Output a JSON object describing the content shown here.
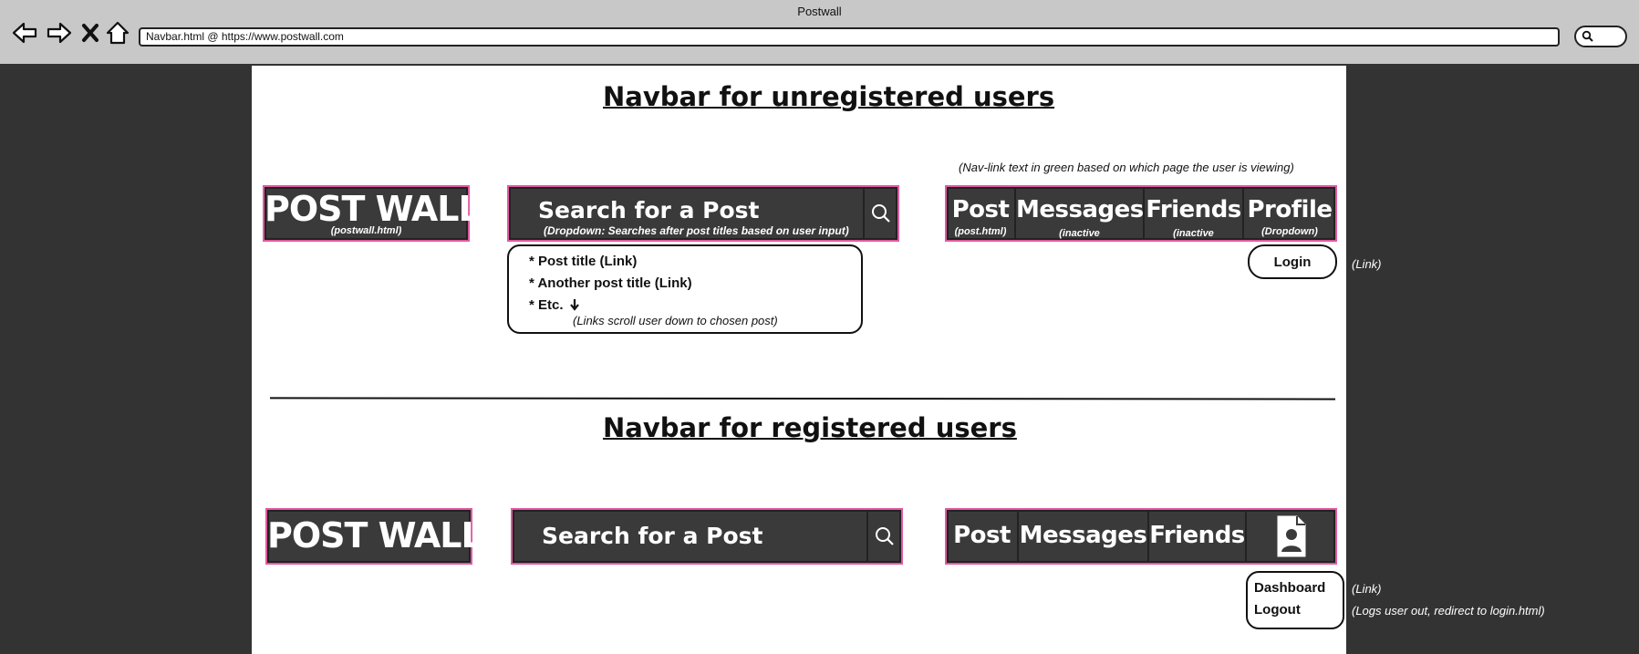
{
  "browser": {
    "title": "Postwall",
    "url": "Navbar.html @ https://www.postwall.com"
  },
  "section1": {
    "heading": "Navbar for unregistered users",
    "nav_note": "(Nav-link text in green based on which page the user is viewing)",
    "logo": {
      "text": "POST WALL",
      "sub": "(postwall.html)"
    },
    "search": {
      "placeholder": "Search for a Post",
      "sub": "(Dropdown: Searches after post titles based on user input)"
    },
    "nav": [
      {
        "label": "Post",
        "sub": "(post.html)"
      },
      {
        "label": "Messages",
        "sub": "(inactive"
      },
      {
        "label": "Friends",
        "sub": "(inactive"
      },
      {
        "label": "Profile",
        "sub": "(Dropdown)"
      }
    ],
    "dropdown": {
      "items": [
        "* Post title (Link)",
        "* Another post title (Link)",
        "* Etc."
      ],
      "note": "(Links scroll user down to chosen post)"
    },
    "login": {
      "label": "Login",
      "note": "(Link)"
    }
  },
  "section2": {
    "heading": "Navbar for registered users",
    "logo": {
      "text": "POST WALL"
    },
    "search": {
      "placeholder": "Search for a Post"
    },
    "nav": [
      {
        "label": "Post"
      },
      {
        "label": "Messages"
      },
      {
        "label": "Friends"
      }
    ],
    "profile_icon": "user-profile-icon",
    "profile_menu": {
      "items": [
        "Dashboard",
        "Logout"
      ],
      "notes": [
        "(Link)",
        "(Logs user out, redirect to login.html)"
      ]
    }
  },
  "colors": {
    "navbar_bg": "#3a3a3a",
    "navbar_border": "#e05aa0",
    "outer_bg": "#333333",
    "chrome_bg": "#c8c8c8"
  }
}
